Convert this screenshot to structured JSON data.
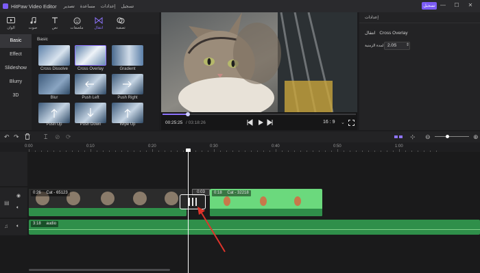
{
  "app": {
    "title": "HitPaw Video Editor",
    "menu": [
      "تصدير",
      "مساعدة",
      "إعدادات",
      "تسجيل"
    ],
    "register_label": "تسجيل",
    "accent": "#7b5cf5"
  },
  "toolbar": {
    "tabs": [
      {
        "label": "الوان",
        "icon": "media-icon"
      },
      {
        "label": "صوت",
        "icon": "music-icon"
      },
      {
        "label": "نص",
        "icon": "text-icon"
      },
      {
        "label": "ملصقات",
        "icon": "sticker-icon"
      },
      {
        "label": "انتقال",
        "icon": "transition-icon",
        "active": true
      },
      {
        "label": "تصفية",
        "icon": "filter-icon"
      }
    ]
  },
  "sidebar": {
    "items": [
      "Basic",
      "Effect",
      "Slideshow",
      "Blurry",
      "3D"
    ]
  },
  "gallery": {
    "heading": "Basic",
    "items": [
      "Cross Dissolve",
      "Cross Overlay",
      "Gradient",
      "Blur",
      "Push Left",
      "Push Right",
      "Push Up",
      "Push Down",
      "Wipe Up"
    ]
  },
  "preview": {
    "current_time": "00:25:25",
    "total_time": "/ 03:18:26",
    "progress_fraction": 0.13,
    "aspect_ratio": "16 : 9"
  },
  "properties": {
    "header": "إعدادات",
    "transition_label": "انتقال",
    "transition_value": "Cross Overlay",
    "duration_label": "المدة الزمنية",
    "duration_value": "2.0S"
  },
  "ruler": {
    "labels": [
      "0:00",
      "0:10",
      "0:20",
      "0:30",
      "0:40",
      "0:50",
      "1:00"
    ]
  },
  "timeline": {
    "clip1": {
      "duration": "0:26",
      "name": "Cat - 65123"
    },
    "transition_badge": "0:03",
    "clip2": {
      "duration": "0:18",
      "name": "Cat - 32218"
    },
    "audio": {
      "duration": "3:18",
      "name": "audio"
    }
  }
}
